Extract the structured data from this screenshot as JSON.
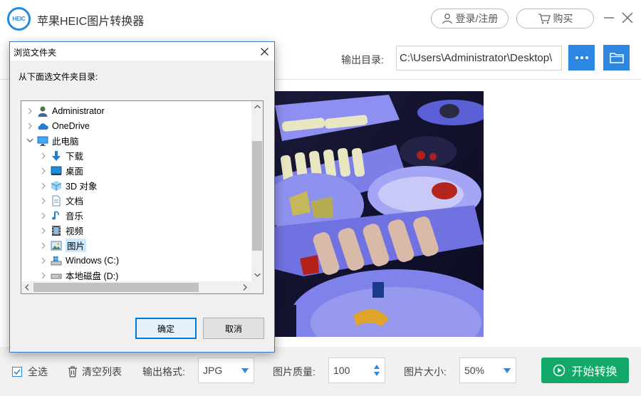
{
  "app": {
    "logo_text": "HEIC",
    "title": "苹果HEIC图片转换器",
    "login_label": "登录/注册",
    "buy_label": "购买"
  },
  "output": {
    "label": "输出目录:",
    "path": "C:\\Users\\Administrator\\Desktop\\"
  },
  "dialog": {
    "title": "浏览文件夹",
    "instruction": "从下面选文件夹目录:",
    "tree": [
      {
        "label": "Administrator",
        "icon": "user-icon",
        "level": 0,
        "expanded": false
      },
      {
        "label": "OneDrive",
        "icon": "cloud-icon",
        "level": 0,
        "expanded": false
      },
      {
        "label": "此电脑",
        "icon": "computer-icon",
        "level": 0,
        "expanded": true
      },
      {
        "label": "下载",
        "icon": "download-icon",
        "level": 1,
        "expanded": false
      },
      {
        "label": "桌面",
        "icon": "desktop-icon",
        "level": 1,
        "expanded": false
      },
      {
        "label": "3D 对象",
        "icon": "cube-icon",
        "level": 1,
        "expanded": false
      },
      {
        "label": "文档",
        "icon": "document-icon",
        "level": 1,
        "expanded": false
      },
      {
        "label": "音乐",
        "icon": "music-icon",
        "level": 1,
        "expanded": false
      },
      {
        "label": "视频",
        "icon": "video-icon",
        "level": 1,
        "expanded": false
      },
      {
        "label": "图片",
        "icon": "picture-icon",
        "level": 1,
        "expanded": false,
        "selected": true
      },
      {
        "label": "Windows (C:)",
        "icon": "windows-drive-icon",
        "level": 1,
        "expanded": false
      },
      {
        "label": "本地磁盘 (D:)",
        "icon": "drive-icon",
        "level": 1,
        "expanded": false
      }
    ],
    "ok_label": "确定",
    "cancel_label": "取消"
  },
  "bottom": {
    "select_all_label": "全选",
    "select_all_checked": true,
    "clear_list_label": "清空列表",
    "format_label": "输出格式:",
    "format_value": "JPG",
    "quality_label": "图片质量:",
    "quality_value": "100",
    "size_label": "图片大小:",
    "size_value": "50%",
    "start_label": "开始转换"
  },
  "colors": {
    "accent_blue": "#2d87e2",
    "start_green": "#12a86a",
    "selection": "#cce8ff"
  }
}
